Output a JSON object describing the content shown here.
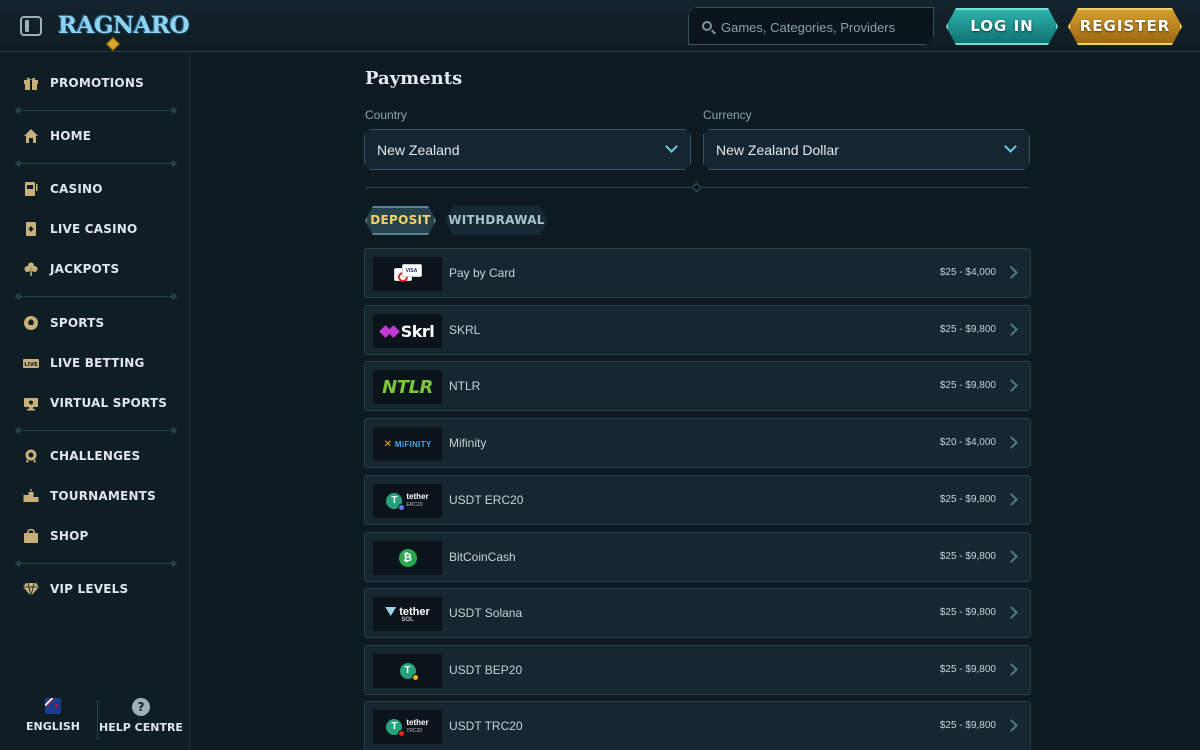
{
  "header": {
    "logo_text": "RAGNARO",
    "search_placeholder": "Games, Categories, Providers",
    "login_label": "LOG IN",
    "register_label": "REGISTER"
  },
  "sidebar": {
    "items": [
      {
        "label": "PROMOTIONS",
        "icon": "gift-icon"
      },
      {
        "label": "HOME",
        "icon": "home-icon"
      },
      {
        "label": "CASINO",
        "icon": "slot-machine-icon"
      },
      {
        "label": "LIVE CASINO",
        "icon": "playing-card-icon"
      },
      {
        "label": "JACKPOTS",
        "icon": "clover-icon"
      },
      {
        "label": "SPORTS",
        "icon": "ball-icon"
      },
      {
        "label": "LIVE BETTING",
        "icon": "live-icon"
      },
      {
        "label": "VIRTUAL SPORTS",
        "icon": "trophy-icon"
      },
      {
        "label": "CHALLENGES",
        "icon": "medal-icon"
      },
      {
        "label": "TOURNAMENTS",
        "icon": "podium-icon"
      },
      {
        "label": "SHOP",
        "icon": "shopping-bag-icon"
      },
      {
        "label": "VIP LEVELS",
        "icon": "diamond-icon"
      }
    ],
    "footer": {
      "language_label": "ENGLISH",
      "help_label": "HELP CENTRE",
      "help_icon_glyph": "?"
    }
  },
  "main": {
    "title": "Payments",
    "country_label": "Country",
    "country_value": "New Zealand",
    "currency_label": "Currency",
    "currency_value": "New Zealand Dollar",
    "tabs": [
      {
        "label": "DEPOSIT",
        "active": true
      },
      {
        "label": "WITHDRAWAL",
        "active": false
      }
    ],
    "methods": [
      {
        "name": "Pay by Card",
        "limits": "$25 - $4,000",
        "logo": "card-logo"
      },
      {
        "name": "SKRL",
        "limits": "$25 - $9,800",
        "logo": "skrl-logo"
      },
      {
        "name": "NTLR",
        "limits": "$25 - $9,800",
        "logo": "ntlr-logo"
      },
      {
        "name": "Mifinity",
        "limits": "$20 - $4,000",
        "logo": "mifinity-logo"
      },
      {
        "name": "USDT ERC20",
        "limits": "$25 - $9,800",
        "logo": "tether-erc20-logo"
      },
      {
        "name": "BitCoinCash",
        "limits": "$25 - $9,800",
        "logo": "bitcoincash-logo"
      },
      {
        "name": "USDT Solana",
        "limits": "$25 - $9,800",
        "logo": "tether-sol-logo"
      },
      {
        "name": "USDT BEP20",
        "limits": "$25 - $9,800",
        "logo": "tether-bep20-logo"
      },
      {
        "name": "USDT TRC20",
        "limits": "$25 - $9,800",
        "logo": "tether-trc20-logo"
      }
    ],
    "logo_texts": {
      "visa": "VISA",
      "skrl": "Skrl",
      "ntlr": "NTLR",
      "mifinity": "MiFINITY",
      "tether": "tether",
      "erc20": "ERC20",
      "sol": "SOL",
      "trc20": "TRC20",
      "tether_glyph": "T",
      "bch_glyph": "₿"
    }
  },
  "colors": {
    "background": "#0d1a21",
    "login_button": "#1f9a94",
    "register_button": "#c58a22",
    "accent_blue": "#6ec7e8",
    "deposit_tab_text": "#f1d36a"
  }
}
